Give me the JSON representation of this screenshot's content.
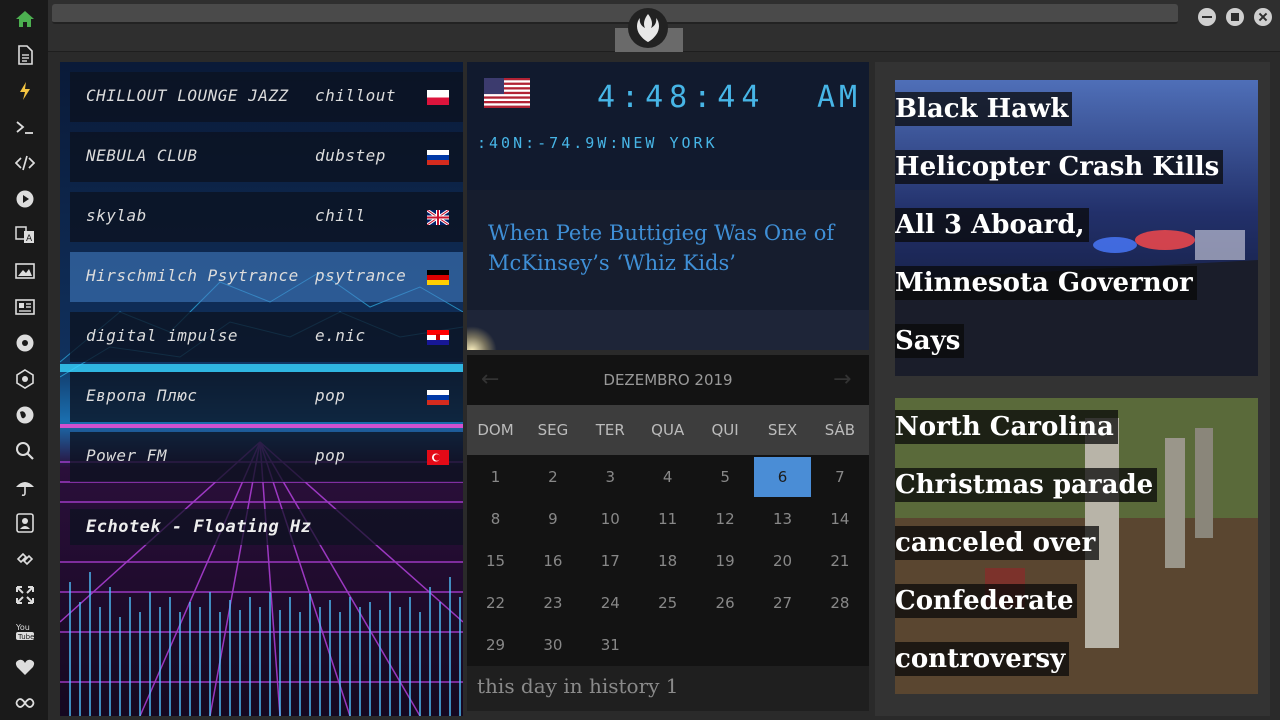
{
  "sidebar": {
    "items": [
      {
        "icon": "home-icon"
      },
      {
        "icon": "document-icon"
      },
      {
        "icon": "lightning-icon"
      },
      {
        "icon": "terminal-icon"
      },
      {
        "icon": "code-icon"
      },
      {
        "icon": "play-icon"
      },
      {
        "icon": "translate-icon"
      },
      {
        "icon": "image-icon"
      },
      {
        "icon": "news-icon"
      },
      {
        "icon": "rebel-icon"
      },
      {
        "icon": "empire-icon"
      },
      {
        "icon": "globe-icon"
      },
      {
        "icon": "search-icon"
      },
      {
        "icon": "umbrella-icon"
      },
      {
        "icon": "contact-icon"
      },
      {
        "icon": "link-icon"
      },
      {
        "icon": "fullscreen-icon"
      },
      {
        "icon": "youtube-icon"
      },
      {
        "icon": "heart-icon"
      },
      {
        "icon": "infinity-icon"
      }
    ],
    "accent_home": "#4caf50",
    "accent_lightning": "#f5c542"
  },
  "radio": {
    "stations": [
      {
        "name": "CHILLOUT LOUNGE JAZZ",
        "genre": "chillout",
        "flag": "pl"
      },
      {
        "name": "NEBULA CLUB",
        "genre": "dubstep",
        "flag": "ru"
      },
      {
        "name": "skylab",
        "genre": "chill",
        "flag": "gb"
      },
      {
        "name": "Hirschmilch Psytrance",
        "genre": "psytrance",
        "flag": "de"
      },
      {
        "name": "digital impulse",
        "genre": "e.nic",
        "flag": "hr"
      },
      {
        "name": "Европа Плюс",
        "genre": "pop",
        "flag": "ru"
      },
      {
        "name": "Power FM",
        "genre": "pop",
        "flag": "tr"
      }
    ],
    "active_index": 3,
    "now_playing": "Echotek - Floating Hz"
  },
  "clock": {
    "time": "4:48:44",
    "ampm": "AM",
    "location": ":40N:-74.9W:NEW YORK",
    "flag": "us",
    "color": "#47b5e6"
  },
  "headline": {
    "text": "When Pete Buttigieg Was One of McKinsey’s ‘Whiz Kids’"
  },
  "calendar": {
    "month_label": "DEZEMBRO 2019",
    "weekdays": [
      "DOM",
      "SEG",
      "TER",
      "QUA",
      "QUI",
      "SEX",
      "SÁB"
    ],
    "days": [
      "1",
      "2",
      "3",
      "4",
      "5",
      "6",
      "7",
      "8",
      "9",
      "10",
      "11",
      "12",
      "13",
      "14",
      "15",
      "16",
      "17",
      "18",
      "19",
      "20",
      "21",
      "22",
      "23",
      "24",
      "25",
      "26",
      "27",
      "28",
      "29",
      "30",
      "31"
    ],
    "today": "6",
    "prev_arrow": "←",
    "next_arrow": "→",
    "history_text": "this day in history 1",
    "highlight_color": "#4a8dd6"
  },
  "news": [
    {
      "title": "Black Hawk Helicopter Crash Kills All 3 Aboard, Minnesota Governor Says"
    },
    {
      "title": "North Carolina Christmas parade canceled over Confederate controversy"
    }
  ]
}
